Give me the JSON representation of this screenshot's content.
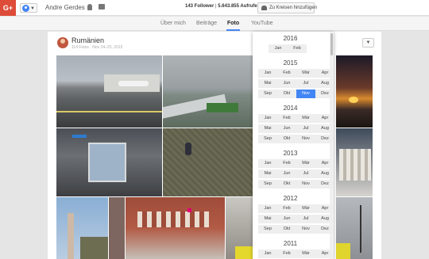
{
  "topbar": {
    "logo": "G+",
    "username": "Andre Gerdes",
    "stats_followers": "143 Follower",
    "stats_separator": "|",
    "stats_views": "5.643.855 Aufrufe",
    "add_button": "Zu Kreisen hinzufügen"
  },
  "tabs": [
    {
      "label": "Über mich"
    },
    {
      "label": "Beiträge"
    },
    {
      "label": "Foto"
    },
    {
      "label": "YouTube"
    }
  ],
  "album": {
    "title": "Rumänien",
    "meta": "114 Fotos · Nov 24–25, 2015"
  },
  "dropdown": {
    "years": [
      {
        "year": "2016",
        "months": [
          "Jan",
          "Feb"
        ]
      },
      {
        "year": "2015",
        "months": [
          "Jan",
          "Feb",
          "Mär",
          "Apr",
          "Mai",
          "Jun",
          "Jul",
          "Aug",
          "Sep",
          "Okt",
          "Nov",
          "Dez"
        ],
        "selected": "Nov"
      },
      {
        "year": "2014",
        "months": [
          "Jan",
          "Feb",
          "Mär",
          "Apr",
          "Mai",
          "Jun",
          "Jul",
          "Aug",
          "Sep",
          "Okt",
          "Nov",
          "Dez"
        ]
      },
      {
        "year": "2013",
        "months": [
          "Jan",
          "Feb",
          "Mär",
          "Apr",
          "Mai",
          "Jun",
          "Jul",
          "Aug",
          "Sep",
          "Okt",
          "Nov",
          "Dez"
        ]
      },
      {
        "year": "2012",
        "months": [
          "Jan",
          "Feb",
          "Mär",
          "Apr",
          "Mai",
          "Jun",
          "Jul",
          "Aug",
          "Sep",
          "Okt",
          "Nov",
          "Dez"
        ]
      },
      {
        "year": "2011",
        "months": [
          "Jan",
          "Feb",
          "Mär",
          "Apr"
        ]
      }
    ]
  },
  "colors": {
    "brand_red": "#dd4b39",
    "accent_blue": "#4285f4"
  }
}
